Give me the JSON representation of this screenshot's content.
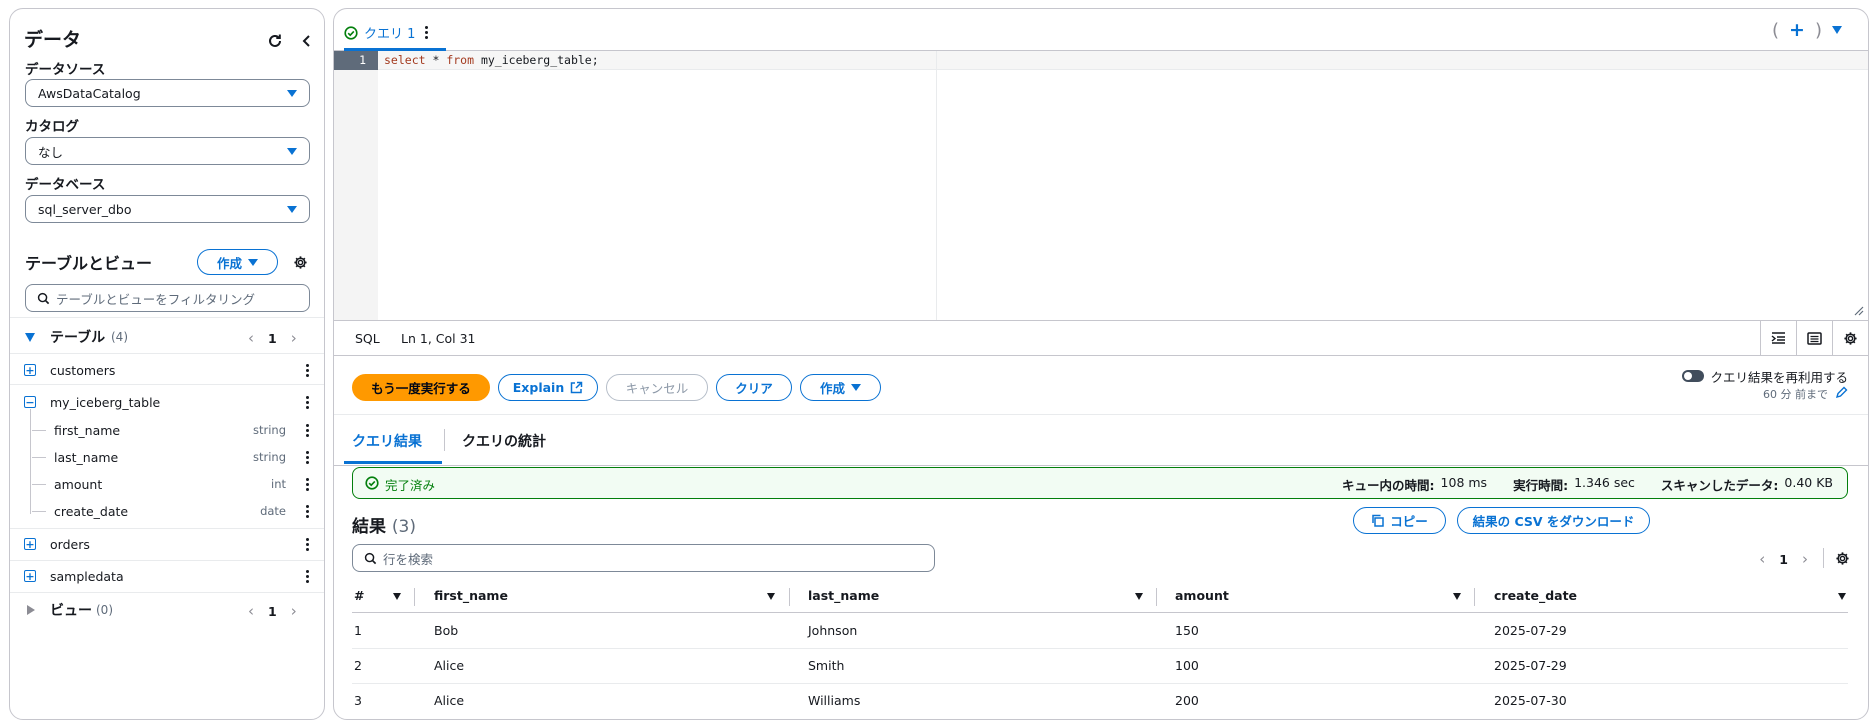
{
  "left_panel": {
    "title": "データ",
    "datasource_label": "データソース",
    "datasource_value": "AwsDataCatalog",
    "catalog_label": "カタログ",
    "catalog_value": "なし",
    "database_label": "データベース",
    "database_value": "sql_server_dbo",
    "tables_views_title": "テーブルとビュー",
    "create_label": "作成",
    "filter_placeholder": "テーブルとビューをフィルタリング",
    "tables_section_label": "テーブル",
    "tables_count": "(4)",
    "tables_page": "1",
    "tables": [
      {
        "name": "customers",
        "expanded": false
      },
      {
        "name": "my_iceberg_table",
        "expanded": true
      },
      {
        "name": "orders",
        "expanded": false
      },
      {
        "name": "sampledata",
        "expanded": false
      }
    ],
    "columns": [
      {
        "name": "first_name",
        "type": "string"
      },
      {
        "name": "last_name",
        "type": "string"
      },
      {
        "name": "amount",
        "type": "int"
      },
      {
        "name": "create_date",
        "type": "date"
      }
    ],
    "views_section_label": "ビュー",
    "views_count": "(0)",
    "views_page": "1"
  },
  "editor": {
    "tab_label": "クエリ 1",
    "line_number": "1",
    "code_kw_select": "select",
    "code_mid": " * ",
    "code_kw_from": "from",
    "code_rest": " my_iceberg_table;",
    "language": "SQL",
    "cursor_pos": "Ln 1, Col 31"
  },
  "actions": {
    "rerun_label": "もう一度実行する",
    "explain_label": "Explain",
    "cancel_label": "キャンセル",
    "clear_label": "クリア",
    "create_label": "作成",
    "reuse_label": "クエリ結果を再利用する",
    "reuse_sub": "60 分 前まで"
  },
  "results": {
    "tab_results": "クエリ結果",
    "tab_stats": "クエリの統計",
    "status": "完了済み",
    "queue_time_label": "キュー内の時間:",
    "queue_time_value": "108 ms",
    "exec_time_label": "実行時間:",
    "exec_time_value": "1.346 sec",
    "scanned_label": "スキャンしたデータ:",
    "scanned_value": "0.40 KB",
    "title": "結果",
    "count": "(3)",
    "copy_label": "コピー",
    "download_label": "結果の CSV をダウンロード",
    "search_placeholder": "行を検索",
    "page": "1",
    "columns": [
      "#",
      "first_name",
      "last_name",
      "amount",
      "create_date"
    ],
    "rows": [
      [
        "1",
        "Bob",
        "Johnson",
        "150",
        "2025-07-29"
      ],
      [
        "2",
        "Alice",
        "Smith",
        "100",
        "2025-07-29"
      ],
      [
        "3",
        "Alice",
        "Williams",
        "200",
        "2025-07-30"
      ]
    ]
  },
  "colors": {
    "accent": "#0972d3",
    "primary_button": "#ff9900",
    "success": "#037f0c"
  }
}
